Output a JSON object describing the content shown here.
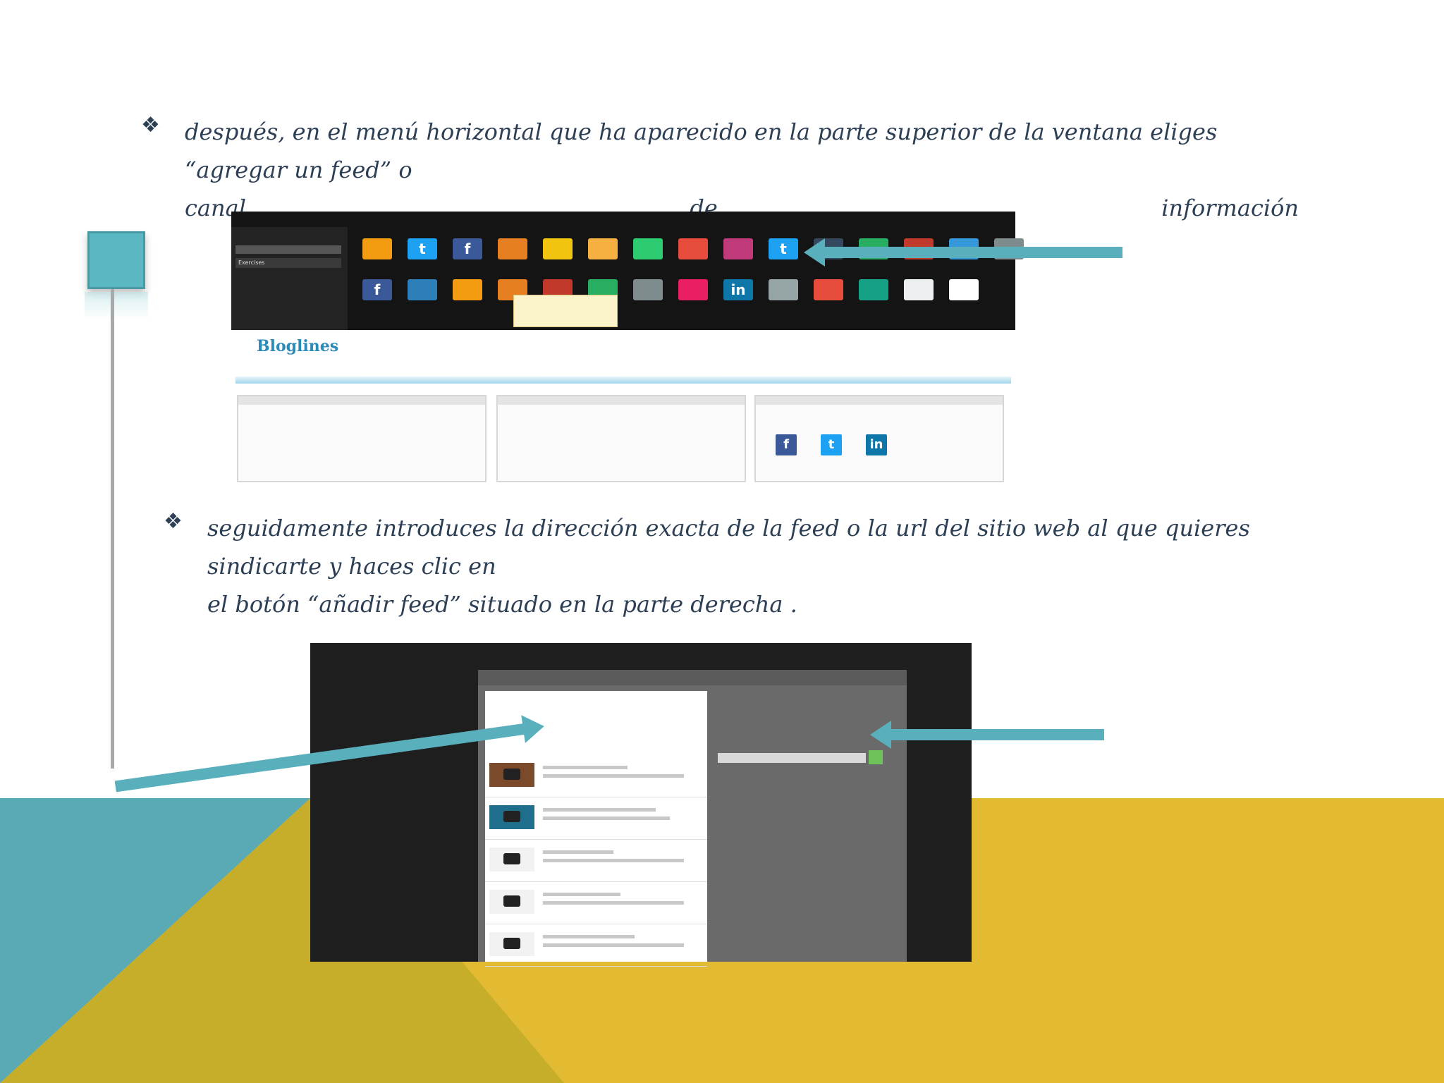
{
  "bullets": [
    {
      "text_line1": "después, en el menú horizontal que ha aparecido en la parte superior de la ventana eliges “agregar un feed” o",
      "text_line2_words": [
        "canal",
        "de",
        "información"
      ]
    },
    {
      "text_line1": "seguidamente introduces la dirección exacta de la feed o la url del sitio web al que quieres sindicarte y haces clic en",
      "text_line2": "el botón “añadir feed” situado en la parte derecha ."
    }
  ],
  "screenshot1": {
    "sidebar_item": "Exercises",
    "logo": "Bloglines",
    "tile_glyphs": [
      "",
      "t",
      "f",
      "",
      "",
      "",
      "",
      "",
      "",
      "t",
      "",
      "",
      "",
      "",
      ""
    ],
    "tile_colors": [
      "#f39c12",
      "#1da1f2",
      "#3b5998",
      "#e67e22",
      "#f1c40f",
      "#f5b041",
      "#2ecc71",
      "#e74c3c",
      "#c0397b",
      "#1da1f2",
      "#34495e",
      "#27ae60",
      "#c0392b",
      "#3498db",
      "#7f8c8d"
    ],
    "tile_row2_glyphs": [
      "f",
      "",
      "",
      "",
      "",
      "",
      "",
      "",
      "in",
      "",
      "",
      "",
      "",
      ""
    ],
    "tile_row2_colors": [
      "#3b5998",
      "#2c7fb8",
      "#f39c12",
      "#e67e22",
      "#c0392b",
      "#27ae60",
      "#7f8c8d",
      "#e91e63",
      "#0e76a8",
      "#95a5a6",
      "#e74c3c",
      "#16a085",
      "#ecf0f1",
      "#ffffff"
    ],
    "social_glyphs": [
      "f",
      "t",
      "in"
    ],
    "social_colors": [
      "#3b5998",
      "#1da1f2",
      "#0e76a8"
    ]
  },
  "colors": {
    "text": "#2d3f55",
    "accent_teal": "#5aafbc",
    "yellow": "#e3bb33"
  }
}
